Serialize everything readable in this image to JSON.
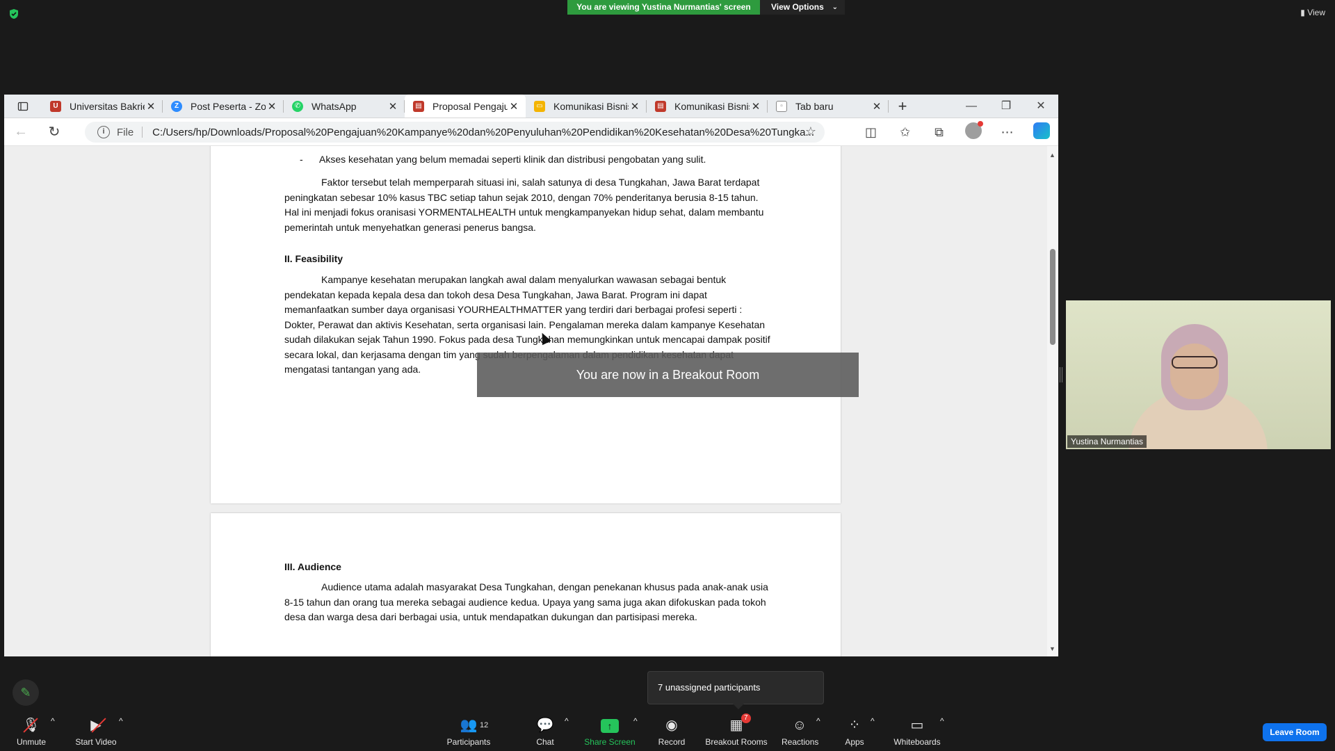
{
  "zoom": {
    "viewing_banner": "You are viewing Yustina Nurmantias' screen",
    "view_options": "View Options",
    "view_label": "View",
    "breakout_toast": "You are now in a Breakout Room",
    "tooltip": "7 unassigned participants",
    "participant_name": "Yustina Nurmantias",
    "toolbar": {
      "unmute": "Unmute",
      "start_video": "Start Video",
      "participants": "Participants",
      "participants_count": "12",
      "chat": "Chat",
      "share_screen": "Share Screen",
      "record": "Record",
      "breakout_rooms": "Breakout Rooms",
      "breakout_badge": "7",
      "reactions": "Reactions",
      "apps": "Apps",
      "whiteboards": "Whiteboards",
      "leave_room": "Leave Room"
    }
  },
  "browser": {
    "tabs": [
      {
        "title": "Universitas Bakrie",
        "icon": "university-icon",
        "color": "#c0392b"
      },
      {
        "title": "Post Peserta - Zoom",
        "icon": "zoom-icon",
        "color": "#2d8cff"
      },
      {
        "title": "WhatsApp",
        "icon": "whatsapp-icon",
        "color": "#25d366"
      },
      {
        "title": "Proposal Pengajuan",
        "icon": "pdf-icon",
        "color": "#c0392b"
      },
      {
        "title": "Komunikasi Bisnis",
        "icon": "slides-icon",
        "color": "#f4b400"
      },
      {
        "title": "Komunikasi Bisnis",
        "icon": "pdf-icon",
        "color": "#c0392b"
      },
      {
        "title": "Tab baru",
        "icon": "newtab-icon",
        "color": "#888888"
      }
    ],
    "file_label": "File",
    "url": "C:/Users/hp/Downloads/Proposal%20Pengajuan%20Kampanye%20dan%20Penyuluhan%20Pendidikan%20Kesehatan%20Desa%20Tungka..."
  },
  "document": {
    "bullet": "Akses kesehatan yang belum memadai seperti klinik dan distribusi pengobatan yang sulit.",
    "para1": "Faktor tersebut telah memperparah situasi ini, salah satunya di desa Tungkahan, Jawa Barat terdapat peningkatan sebesar 10% kasus TBC setiap tahun sejak 2010, dengan 70% penderitanya berusia 8-15 tahun. Hal ini menjadi fokus oranisasi YORMENTALHEALTH untuk mengkampanyekan hidup sehat, dalam membantu pemerintah untuk menyehatkan generasi penerus bangsa.",
    "heading2": "II. Feasibility",
    "para2": "Kampanye kesehatan merupakan langkah awal dalam menyalurkan wawasan sebagai bentuk pendekatan kepada kepala desa dan tokoh desa Desa Tungkahan, Jawa Barat. Program ini dapat memanfaatkan sumber daya organisasi YOURHEALTHMATTER yang terdiri dari berbagai profesi seperti : Dokter, Perawat dan aktivis Kesehatan, serta organisasi lain. Pengalaman mereka dalam kampanye Kesehatan sudah dilakukan sejak Tahun 1990. Fokus pada desa Tungkahan memungkinkan untuk mencapai dampak positif secara lokal, dan kerjasama dengan tim yang sudah berpengalaman dalam pendidikan kesehatan dapat mengatasi tantangan yang ada.",
    "heading3": "III. Audience",
    "para3": "Audience utama adalah masyarakat Desa Tungkahan, dengan penekanan khusus pada anak-anak usia 8-15 tahun dan orang tua mereka sebagai audience kedua. Upaya yang sama juga akan difokuskan pada tokoh desa dan warga desa dari berbagai usia, untuk mendapatkan dukungan dan partisipasi mereka."
  }
}
